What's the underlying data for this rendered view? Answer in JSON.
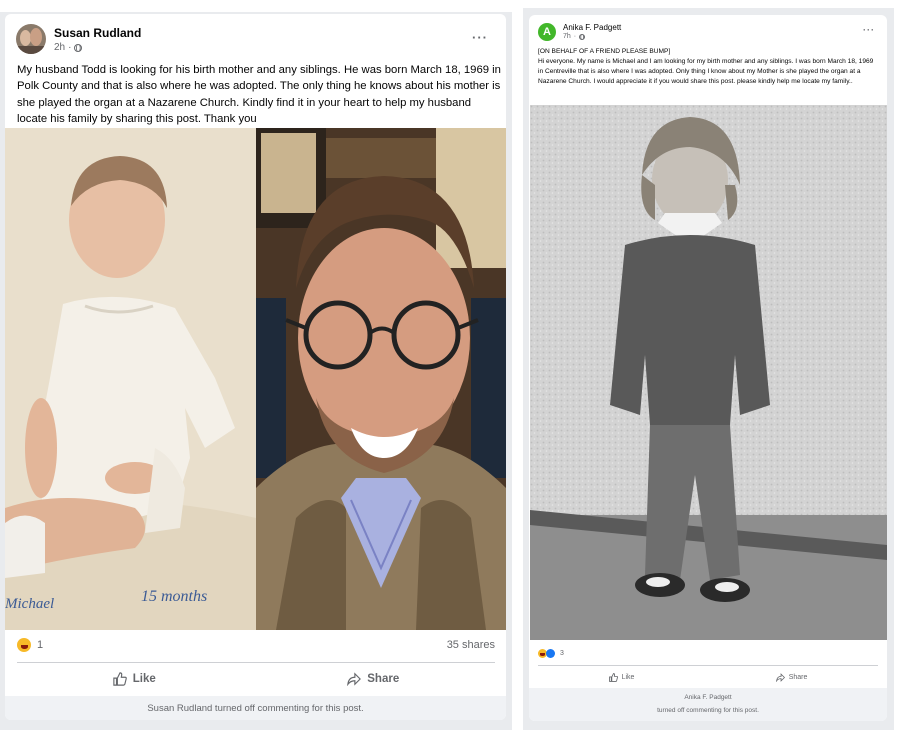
{
  "left_post": {
    "author": "Susan Rudland",
    "time": "2h",
    "text": "My husband Todd is looking for his birth mother and any siblings. He was born March 18, 1969 in Polk County and that is also where he was adopted. The only thing he knows about his mother is she played the organ at a Nazarene Church. Kindly find it in your heart to help my husband locate his family by sharing this post. Thank you",
    "photo_caption_name": "Michael",
    "photo_caption_age": "15 months",
    "reaction_count": "1",
    "shares": "35 shares",
    "like_label": "Like",
    "share_label": "Share",
    "footer": "Susan Rudland turned off commenting for this post.",
    "more_label": "···"
  },
  "right_post": {
    "avatar_letter": "A",
    "author": "Anika F. Padgett",
    "time": "7h",
    "text_line1": "[ON BEHALF OF A FRIEND PLEASE BUMP]",
    "text_body": "Hi everyone. My name is Michael and I am looking for my birth mother and any siblings. I was born March 18, 1969 in Centreville that is also where I was adopted. Only thing I know about my Mother is she played the organ at a Nazarene Church. I would appreciate it if you would share this post. please kindly help me locate my family..",
    "reaction_count": "3",
    "like_label": "Like",
    "share_label": "Share",
    "footer_line1": "Anika F. Padgett",
    "footer_line2": "turned off commenting for this post.",
    "more_label": "···"
  },
  "colors": {
    "panel_bg": "#e9ebee",
    "avatar_green": "#42b72a",
    "like_blue": "#1877f2",
    "haha_yellow": "#f7b928",
    "meta_gray": "#65676b"
  }
}
